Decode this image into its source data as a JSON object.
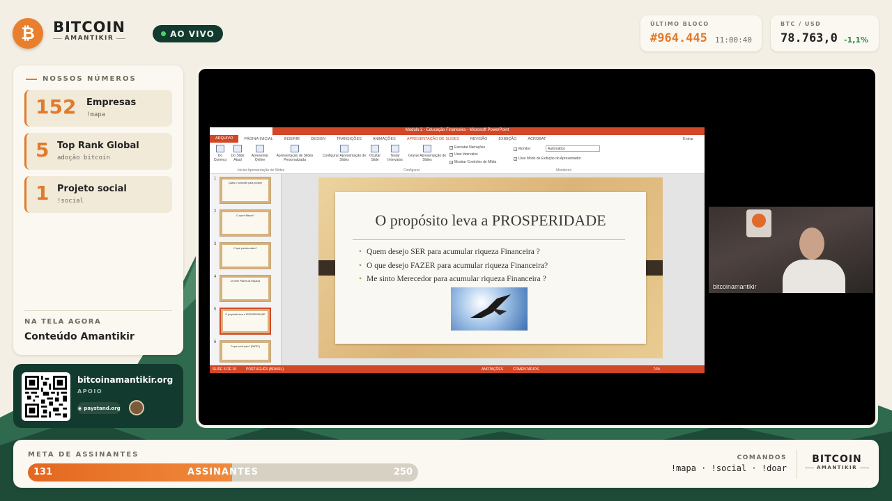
{
  "header": {
    "logo_symbol": "₿",
    "logo_main": "BITCOIN",
    "logo_sub": "AMANTIKIR",
    "live_label": "AO VIVO",
    "block_label": "ÚLTIMO BLOCO",
    "block_height": "#964.445",
    "block_time": "11:00:40",
    "btc_label": "BTC / USD",
    "btc_price": "78.763,0",
    "btc_change": "-1,1%"
  },
  "stats": {
    "title": "NOSSOS NÚMEROS",
    "items": [
      {
        "number": "152",
        "title": "Empresas",
        "sub": "!mapa"
      },
      {
        "number": "5",
        "title": "Top Rank Global",
        "sub": "adoção bitcoin"
      },
      {
        "number": "1",
        "title": "Projeto social",
        "sub": "!social"
      }
    ],
    "now_label": "NA TELA AGORA",
    "now_title": "Conteúdo Amantikir"
  },
  "support": {
    "url": "bitcoinamantikir.org",
    "label": "APOIO",
    "paystand": "paystand.org"
  },
  "ppt": {
    "window_title": "Modulo 2 - Educação Financeira - Microsoft PowerPoint",
    "signin": "Entrar",
    "tabs": [
      "ARQUIVO",
      "PÁGINA INICIAL",
      "INSERIR",
      "DESIGN",
      "TRANSIÇÕES",
      "ANIMAÇÕES",
      "APRESENTAÇÃO DE SLIDES",
      "REVISÃO",
      "EXIBIÇÃO",
      "ACROBAT"
    ],
    "ribbon": {
      "do_comeco": "Do Começo",
      "slide_atual": "Do Slide Atual",
      "apresentar_online": "Apresentar Online",
      "personalizada": "Apresentação de Slides Personalizada",
      "group1": "Iniciar Apresentação de Slides",
      "configurar": "Configurar Apresentação de Slides",
      "ocultar": "Ocultar Slide",
      "testar": "Testar Intervalos",
      "gravar": "Gravar Apresentação de Slides",
      "group2": "Configurar",
      "executar": "Executar Narrações",
      "usar_intervalos": "Usar Intervalos",
      "mostrar_controles": "Mostrar Controles de Mídia",
      "monitor": "Monitor:",
      "monitor_value": "Automático",
      "modo_apresentador": "Usar Modo de Exibição do Apresentador",
      "group3": "Monitores"
    },
    "thumbnails": [
      {
        "num": "1",
        "text": "Quais o horizonte para prosper"
      },
      {
        "num": "2",
        "text": "O que é Bitcoin?"
      },
      {
        "num": "3",
        "text": "O que preciso saber?"
      },
      {
        "num": "4",
        "text": "Os sete Pilares da Riqueza"
      },
      {
        "num": "5",
        "text": "O propósito leva a PROSPERIDADE"
      },
      {
        "num": "6",
        "text": "O que você quer? (PAPEL)"
      }
    ],
    "slide_title": "O propósito leva a PROSPERIDADE",
    "bullets": [
      "Quem desejo SER para acumular riqueza Financeira ?",
      "O que desejo FAZER para acumular riqueza Financeira?",
      "Me sinto Merecedor para acumular riqueza Financeira ?"
    ],
    "status_slide": "SLIDE 5 DE 19",
    "status_lang": "PORTUGUÊS (BRASIL)",
    "status_notes": "ANOTAÇÕES",
    "status_comments": "COMENTÁRIOS",
    "zoom": "74%"
  },
  "webcam": {
    "name": "bitcoinamantikir"
  },
  "goal": {
    "label": "META DE ASSINANTES",
    "current": "131",
    "center": "ASSINANTES",
    "target": "250",
    "progress": 0.524
  },
  "commands": {
    "label": "COMANDOS",
    "list": "!mapa · !social · !doar"
  },
  "colors": {
    "accent": "#e07a2c",
    "dark_green": "#133a2e",
    "ppt_red": "#d24726"
  }
}
